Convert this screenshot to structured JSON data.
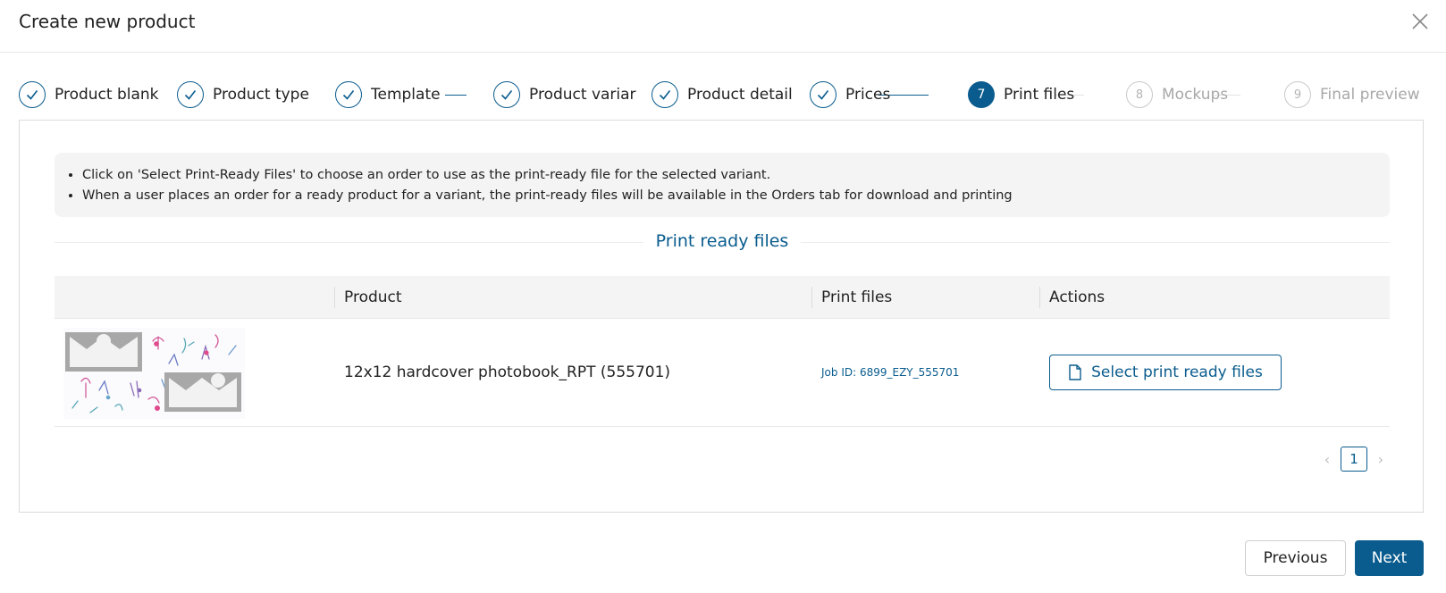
{
  "modal": {
    "title": "Create new product",
    "close_icon": "close-icon"
  },
  "steps": [
    {
      "label": "Product blank",
      "status": "done"
    },
    {
      "label": "Product type",
      "status": "done"
    },
    {
      "label": "Template",
      "status": "done"
    },
    {
      "label": "Product variar",
      "status": "done"
    },
    {
      "label": "Product detail",
      "status": "done"
    },
    {
      "label": "Prices",
      "status": "done"
    },
    {
      "number": "7",
      "label": "Print files",
      "status": "active"
    },
    {
      "number": "8",
      "label": "Mockups",
      "status": "pending"
    },
    {
      "number": "9",
      "label": "Final preview",
      "status": "pending"
    }
  ],
  "info": {
    "items": [
      "Click on 'Select Print-Ready Files' to choose an order to use as the print-ready file for the selected variant.",
      "When a user places an order for a ready product for a variant, the print-ready files will be available in the Orders tab for download and printing"
    ]
  },
  "section": {
    "title": "Print ready files"
  },
  "table": {
    "headers": [
      "",
      "Product",
      "Print files",
      "Actions"
    ],
    "rows": [
      {
        "product": "12x12 hardcover photobook_RPT (555701)",
        "job": "Job ID: 6899_EZY_555701",
        "action": "Select print ready files"
      }
    ]
  },
  "pagination": {
    "current": "1"
  },
  "footer": {
    "previous": "Previous",
    "next": "Next"
  },
  "colors": {
    "accent": "#0a5c8e",
    "border": "#dadada",
    "info_bg": "#f4f4f4",
    "pending": "#b5b5b5"
  }
}
